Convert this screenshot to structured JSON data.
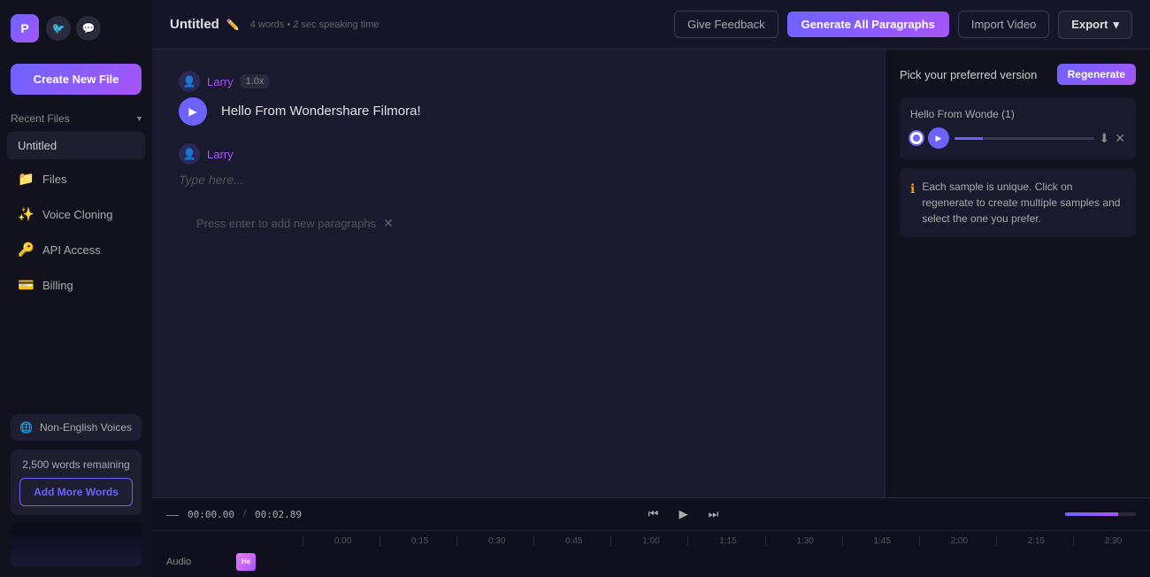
{
  "app": {
    "logo_text": "P",
    "twitter_icon": "🐦",
    "discord_icon": "💬"
  },
  "sidebar": {
    "create_new_label": "Create New File",
    "recent_files_label": "Recent Files",
    "recent_items": [
      {
        "name": "Untitled"
      }
    ],
    "nav_items": [
      {
        "id": "files",
        "label": "Files",
        "icon": "📁"
      },
      {
        "id": "voice-cloning",
        "label": "Voice Cloning",
        "icon": "✨"
      },
      {
        "id": "api-access",
        "label": "API Access",
        "icon": "🔑"
      },
      {
        "id": "billing",
        "label": "Billing",
        "icon": "💳"
      }
    ],
    "non_english_voices_label": "Non-English Voices",
    "words_remaining": "2,500 words remaining",
    "add_more_label": "Add More Words"
  },
  "topbar": {
    "file_title": "Untitled",
    "file_meta": "4 words • 2 sec speaking time",
    "give_feedback_label": "Give Feedback",
    "generate_label": "Generate All Paragraphs",
    "import_video_label": "Import Video",
    "export_label": "Export",
    "export_chevron": "▾"
  },
  "editor": {
    "paragraphs": [
      {
        "speaker": "Larry",
        "speed": "1.0x",
        "text": "Hello From Wondershare Filmora!"
      },
      {
        "speaker": "Larry",
        "speed": null,
        "text": "",
        "placeholder": "Type here..."
      }
    ],
    "press_enter_hint": "Press enter to add new paragraphs",
    "close_icon": "✕"
  },
  "side_panel": {
    "title": "Pick your preferred version",
    "regenerate_label": "Regenerate",
    "sample": {
      "title": "Hello From Wonde (1)",
      "progress_pct": 20
    },
    "info_text": "Each sample is unique. Click on regenerate to create multiple samples and select the one you prefer."
  },
  "timeline": {
    "dash_label": "—",
    "current_time": "00:00.00",
    "separator": "/",
    "total_time": "00:02.89",
    "skip_back_icon": "⏮",
    "play_icon": "▶",
    "skip_forward_icon": "⏭",
    "audio_label": "Audio",
    "clip_label": "He",
    "ruler_marks": [
      "0:00",
      "0:15",
      "0:30",
      "0:45",
      "1:00",
      "1:15",
      "1:30",
      "1:45",
      "2:00",
      "2:15",
      "2:30"
    ]
  }
}
